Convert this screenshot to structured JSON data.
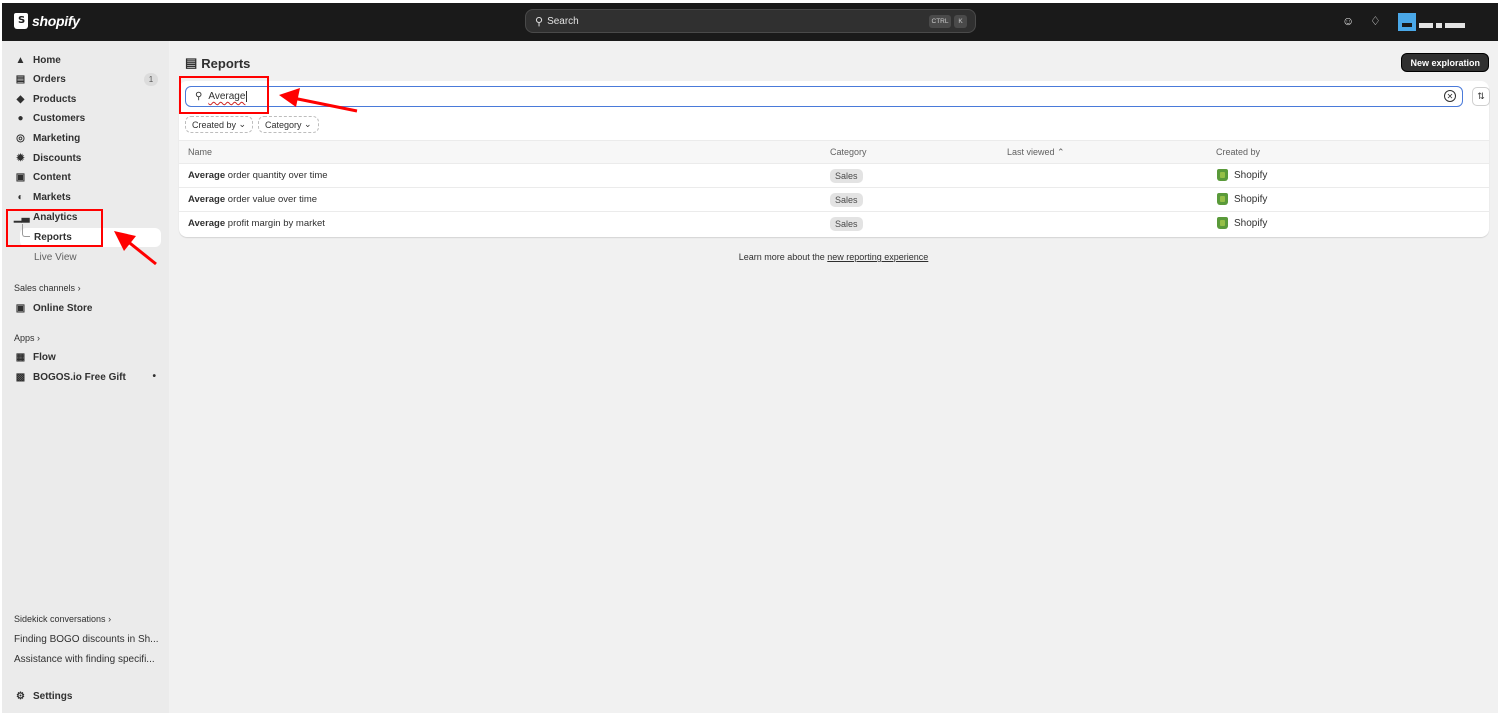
{
  "topbar": {
    "logo_text": "shopify",
    "search_placeholder": "Search",
    "kbd_ctrl": "CTRL",
    "kbd_k": "K"
  },
  "sidebar": {
    "items": [
      {
        "label": "Home",
        "icon": "home-icon"
      },
      {
        "label": "Orders",
        "icon": "inbox-icon",
        "count": "1"
      },
      {
        "label": "Products",
        "icon": "tag-icon"
      },
      {
        "label": "Customers",
        "icon": "person-icon"
      },
      {
        "label": "Marketing",
        "icon": "target-icon"
      },
      {
        "label": "Discounts",
        "icon": "discount-icon"
      },
      {
        "label": "Content",
        "icon": "content-icon"
      },
      {
        "label": "Markets",
        "icon": "globe-icon"
      },
      {
        "label": "Analytics",
        "icon": "bar-chart-icon"
      }
    ],
    "reports_label": "Reports",
    "live_view_label": "Live View",
    "sales_channels_label": "Sales channels",
    "online_store_label": "Online Store",
    "apps_label": "Apps",
    "flow_label": "Flow",
    "bogos_label": "BOGOS.io Free Gift",
    "sidekick_label": "Sidekick conversations",
    "conversations": [
      "Finding BOGO discounts in Sh...",
      "Assistance with finding specifi..."
    ],
    "settings_label": "Settings"
  },
  "main": {
    "title": "Reports",
    "new_button": "New exploration",
    "search_value": "Average",
    "filters": [
      "Created by",
      "Category"
    ],
    "columns": [
      "Name",
      "Category",
      "Last viewed",
      "Created by"
    ],
    "rows": [
      {
        "bold": "Average",
        "rest": " order quantity over time",
        "category": "Sales",
        "created_by": "Shopify"
      },
      {
        "bold": "Average",
        "rest": " order value over time",
        "category": "Sales",
        "created_by": "Shopify"
      },
      {
        "bold": "Average",
        "rest": " profit margin by market",
        "category": "Sales",
        "created_by": "Shopify"
      }
    ],
    "learn_text": "Learn more about the ",
    "learn_link": "new reporting experience"
  },
  "colors": {
    "annotation": "#ff0000",
    "topbar": "#1a1a1a",
    "accent_border": "#4a7ad9"
  }
}
